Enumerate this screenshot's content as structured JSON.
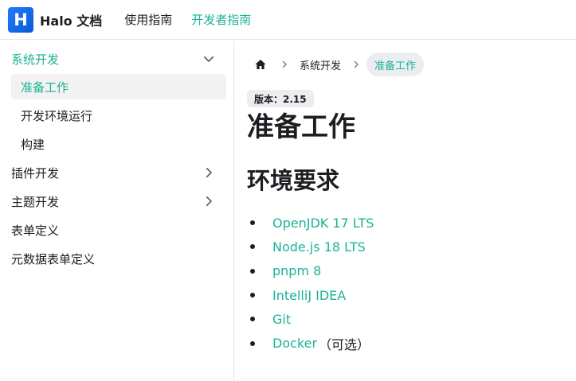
{
  "navbar": {
    "logo_letter": "H",
    "title": "Halo 文档",
    "links": [
      {
        "label": "使用指南"
      },
      {
        "label": "开发者指南"
      }
    ]
  },
  "sidebar": {
    "category_open": {
      "label": "系统开发"
    },
    "children": [
      {
        "label": "准备工作"
      },
      {
        "label": "开发环境运行"
      },
      {
        "label": "构建"
      }
    ],
    "categories": [
      {
        "label": "插件开发"
      },
      {
        "label": "主题开发"
      },
      {
        "label": "表单定义"
      },
      {
        "label": "元数据表单定义"
      }
    ]
  },
  "breadcrumb": {
    "items": [
      {
        "label": "系统开发"
      },
      {
        "label": "准备工作"
      }
    ]
  },
  "version_badge": "版本：2.15",
  "page_title": "准备工作",
  "section_title": "环境要求",
  "requirements": [
    {
      "label": "OpenJDK 17 LTS",
      "note": ""
    },
    {
      "label": "Node.js 18 LTS",
      "note": ""
    },
    {
      "label": "pnpm 8",
      "note": ""
    },
    {
      "label": "IntelliJ IDEA",
      "note": ""
    },
    {
      "label": "Git",
      "note": ""
    },
    {
      "label": "Docker",
      "note": "（可选）"
    }
  ],
  "colors": {
    "accent": "#1bb394",
    "logo": "#1f7bff",
    "active_bg": "#f2f2f3",
    "border": "#e4e6ea"
  }
}
